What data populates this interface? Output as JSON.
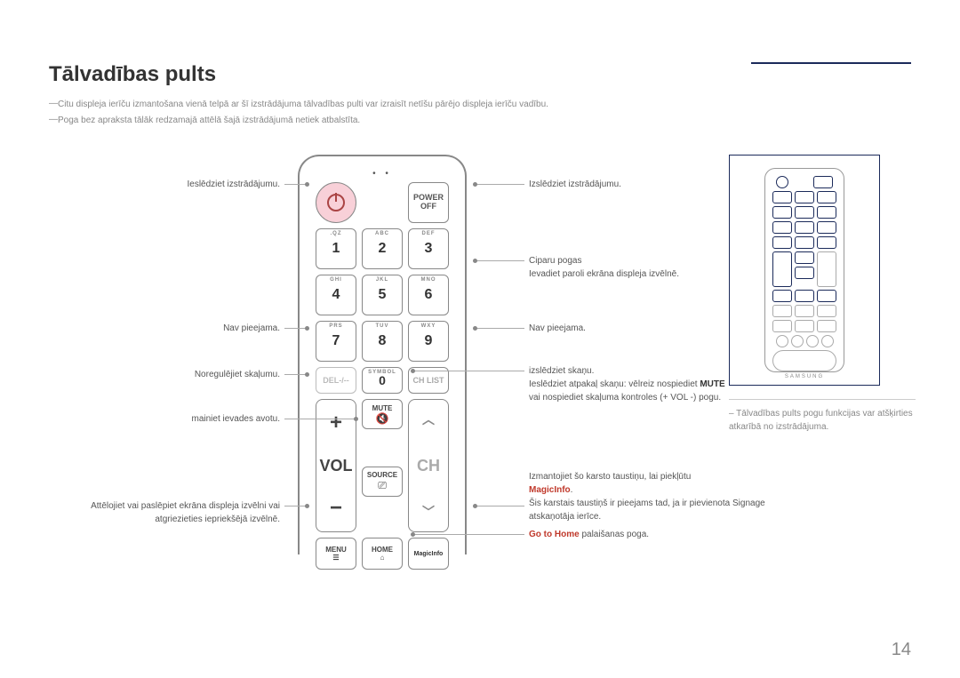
{
  "title": "Tālvadības pults",
  "notes": [
    "Citu displeja ierīču izmantošana vienā telpā ar šī izstrādājuma tālvadības pulti var izraisīt netīšu pārējo displeja ierīču vadību.",
    "Poga bez apraksta tālāk redzamajā attēlā šajā izstrādājumā netiek atbalstīta."
  ],
  "remote": {
    "power_off": {
      "line1": "POWER",
      "line2": "OFF"
    },
    "keypad": [
      [
        {
          "sub": ".QZ",
          "num": "1"
        },
        {
          "sub": "ABC",
          "num": "2"
        },
        {
          "sub": "DEF",
          "num": "3"
        }
      ],
      [
        {
          "sub": "GHI",
          "num": "4"
        },
        {
          "sub": "JKL",
          "num": "5"
        },
        {
          "sub": "MNO",
          "num": "6"
        }
      ],
      [
        {
          "sub": "PRS",
          "num": "7"
        },
        {
          "sub": "TUV",
          "num": "8"
        },
        {
          "sub": "WXY",
          "num": "9"
        }
      ]
    ],
    "row4": {
      "del": "DEL-/--",
      "sym": {
        "sub": "SYMBOL",
        "num": "0"
      },
      "chlist": "CH LIST"
    },
    "vol": "VOL",
    "ch": "CH",
    "mute": "MUTE",
    "source": "SOURCE",
    "menu": "MENU",
    "home": "HOME",
    "magic": "MagicInfo"
  },
  "left_labels": {
    "power_on": "Ieslēdziet izstrādājumu.",
    "na1": "Nav pieejama.",
    "vol": "Noregulējiet skaļumu.",
    "source": "mainiet ievades avotu.",
    "menu": "Attēlojiet vai paslēpiet ekrāna displeja izvēlni vai atgriezieties iepriekšējā izvēlnē."
  },
  "right_labels": {
    "power_off": "Izslēdziet izstrādājumu.",
    "digits1": "Ciparu pogas",
    "digits2": "Ievadiet paroli ekrāna displeja izvēlnē.",
    "na2": "Nav pieejama.",
    "mute1": "izslēdziet skaņu.",
    "mute2a": "Ieslēdziet atpakaļ skaņu: vēlreiz nospiediet ",
    "mute2b": "MUTE",
    "mute3": "vai nospiediet skaļuma kontroles (+ VOL -) pogu.",
    "magic1": "Izmantojiet šo karsto taustiņu, lai piekļūtu",
    "magic_red": "MagicInfo",
    "magic_dot": ".",
    "magic2": "Šis karstais taustiņš ir pieejams tad, ja ir pievienota Signage atskaņotāja ierīce.",
    "home_red": "Go to Home",
    "home_txt": " palaišanas poga."
  },
  "thumb_note": "Tālvadības pults pogu funkcijas var atšķirties atkarībā no izstrādājuma.",
  "page": "14"
}
